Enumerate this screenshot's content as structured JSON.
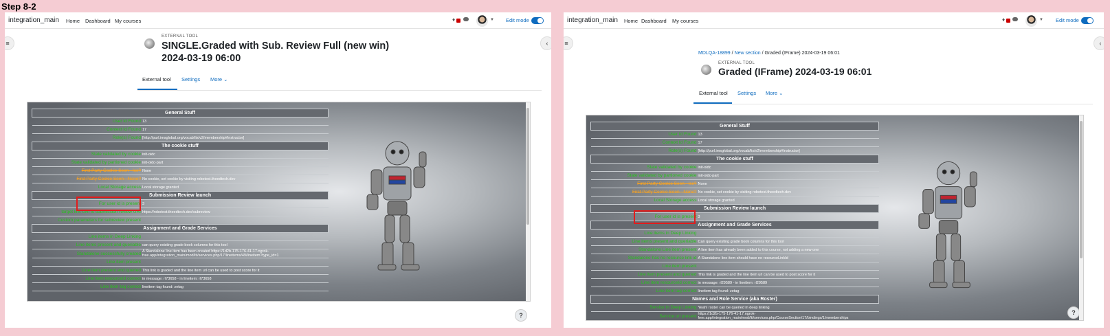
{
  "step_label": "Step 8-2",
  "site_name": "integration_main",
  "nav": {
    "home": "Home",
    "dashboard": "Dashboard",
    "my_courses": "My courses"
  },
  "edit_mode": "Edit mode",
  "external_tool_label": "EXTERNAL TOOL",
  "tabs": {
    "external": "External tool",
    "settings": "Settings",
    "more": "More ⌄"
  },
  "help": "?",
  "panels": [
    {
      "title_line1": "SINGLE.Graded with Sub. Review Full (new win)",
      "title_line2": "2024-03-19 06:00",
      "rows": [
        {
          "s": "General Stuff"
        },
        {
          "k": "User Id Found",
          "v": "13"
        },
        {
          "k": "Context Id Found",
          "v": "17"
        },
        {
          "k": "Role(s) Found",
          "v": "[http://purl.imsglobal.org/vocab/lis/v2/membership#Instructor]"
        },
        {
          "s": "The cookie stuff"
        },
        {
          "k": "State validated by cookie",
          "v": "init-oidc"
        },
        {
          "k": "State validated by partioned cookie",
          "v": "init-oidc-part"
        },
        {
          "k": "First Party Cookie Seen - Iss?",
          "v": "None",
          "w": true
        },
        {
          "k": "First Party Cookie Seen - None?",
          "v": "No cookie, set cookie by visiting robotest.theedtech.dev",
          "w": true
        },
        {
          "k": "Local Storage access",
          "v": "Local storage granted"
        },
        {
          "s": "Submission Review launch"
        },
        {
          "k": "For user id is present",
          "v": "3"
        },
        {
          "k": "target link URI is submission review URI",
          "v": "https://robotest.theedtech.dev/subreview"
        },
        {
          "k": "Custom parameters for subreview present",
          "v": ""
        },
        {
          "s": "Assignment and Grade Services"
        },
        {
          "k": "Line items in Deep Linking",
          "v": ""
        },
        {
          "k": "Line items present and queriable",
          "v": "can query existing grade book columns for this tool"
        },
        {
          "k": "Standalone successfully created",
          "v": "A Standalone line item has been created https://1d2b-175-176-41-17.ngrok-free.app/integration_main/mod/lti/services.php/17/lineitems/49/lineitem?type_id=1"
        },
        {
          "k": "Line item present",
          "v": ""
        },
        {
          "k": "Line item present and queried",
          "v": "This link is graded and the line item url can be used to post score for it"
        },
        {
          "k": "Line item resourceId correct",
          "v": "in message: rl73658 - in lineitem: rl73658"
        },
        {
          "k": "Line item tag correct",
          "v": "lineitem tag found: zetag"
        }
      ]
    },
    {
      "breadcrumb": [
        "MDLQA-18899",
        "New section",
        "Graded (IFrame) 2024-03-19 06:01"
      ],
      "title_line1": "Graded (IFrame) 2024-03-19 06:01",
      "rows": [
        {
          "s": "General Stuff"
        },
        {
          "k": "User Id Found",
          "v": "13"
        },
        {
          "k": "Context Id Found",
          "v": "17"
        },
        {
          "k": "Role(s) Found",
          "v": "[http://purl.imsglobal.org/vocab/lis/v2/membership#Instructor]"
        },
        {
          "s": "The cookie stuff"
        },
        {
          "k": "State validated by cookie",
          "v": "init-oidc"
        },
        {
          "k": "State validated by partioned cookie",
          "v": "init-oidc-part"
        },
        {
          "k": "First Party Cookie Seen - Iss?",
          "v": "None",
          "w": true
        },
        {
          "k": "First Party Cookie Seen - None?",
          "v": "No cookie, set cookie by visiting robotest.theedtech.dev",
          "w": true
        },
        {
          "k": "Local Storage access",
          "v": "Local storage granted"
        },
        {
          "s": "Submission Review launch"
        },
        {
          "k": "For user id is present",
          "v": "3"
        },
        {
          "s": "Assignment and Grade Services"
        },
        {
          "k": "Line items in Deep Linking",
          "v": ""
        },
        {
          "k": "Line items present and queriable",
          "v": "Can query existing grade book columns for this tool"
        },
        {
          "k": "Standalone Line item present",
          "v": "A line item has already been added to this course, not adding a new one"
        },
        {
          "k": "Standalone has no resource link id",
          "v": "A Standalone line item should have no resourceLinkId"
        },
        {
          "k": "Line item present",
          "v": ""
        },
        {
          "k": "Line item present and queried",
          "v": "This link is graded and the line item url can be used to post score for it"
        },
        {
          "k": "Line item resourceId correct",
          "v": "in message: rl29589 - in lineitem: rl29589"
        },
        {
          "k": "Line item tag correct",
          "v": "lineitem tag found: zetag"
        },
        {
          "s": "Names and Role Service (aka Roster)"
        },
        {
          "k": "Service in Deep Linking",
          "v": "Yeah! roster can be queried in deep linking"
        },
        {
          "k": "Service url present",
          "v": "https://1d2b-175-176-41-17.ngrok-free.app/integration_main/mod/lti/services.php/CourseSection/17/bindings/1/memberships"
        }
      ]
    }
  ]
}
